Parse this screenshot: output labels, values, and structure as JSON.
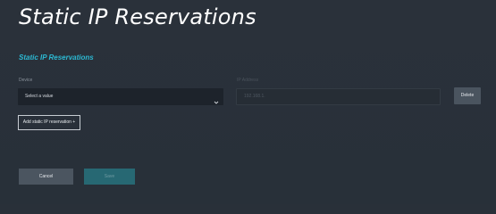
{
  "page": {
    "title": "Static IP Reservations"
  },
  "section": {
    "title": "Static IP Reservations"
  },
  "fields": {
    "device_label": "Device",
    "device_value": "Select a value",
    "ip_label": "IP Address",
    "ip_placeholder": "192.168.1."
  },
  "actions": {
    "delete_label": "Delete",
    "add_label": "Add static IP reservation +",
    "cancel_label": "Cancel",
    "save_label": "Save"
  },
  "colors": {
    "background": "#293039",
    "accent": "#2cb9d3",
    "save_disabled": "#276873"
  },
  "icons": {
    "device_select_chevron": "chevron-down-icon"
  }
}
